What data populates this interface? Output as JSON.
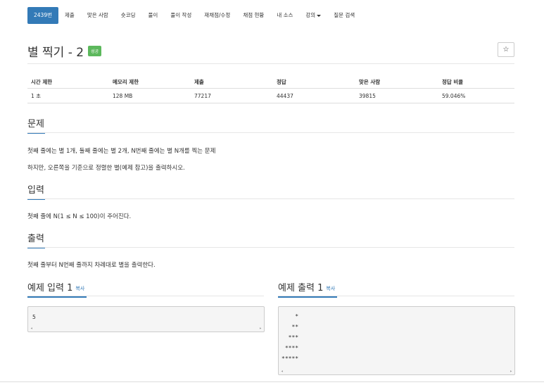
{
  "nav": {
    "tabs": [
      "2439번",
      "제출",
      "맞은 사람",
      "숏코딩",
      "풀이",
      "풀이 작성",
      "재채점/수정",
      "채점 현황",
      "내 소스",
      "강의",
      "질문 검색"
    ]
  },
  "problem": {
    "title": "별 찍기 - 2",
    "badge": "성공",
    "star_icon": "☆"
  },
  "stats": {
    "headers": [
      "시간 제한",
      "메모리 제한",
      "제출",
      "정답",
      "맞은 사람",
      "정답 비율"
    ],
    "values": [
      "1 초",
      "128 MB",
      "77217",
      "44437",
      "39815",
      "59.046%"
    ]
  },
  "sections": {
    "problem_heading": "문제",
    "problem_line1": "첫째 줄에는 별 1개, 둘째 줄에는 별 2개, N번째 줄에는 별 N개를 찍는 문제",
    "problem_line2": "하지만, 오른쪽을 기준으로 정렬한 별(예제 참고)을 출력하시오.",
    "input_heading": "입력",
    "input_text": "첫째 줄에 N(1 ≤ N ≤ 100)이 주어진다.",
    "output_heading": "출력",
    "output_text": "첫째 줄부터 N번째 줄까지 차례대로 별을 출력한다."
  },
  "samples": {
    "input_heading": "예제 입력 1",
    "output_heading": "예제 출력 1",
    "copy_label": "복사",
    "input_lines": [
      "5"
    ],
    "output_lines": [
      "    *",
      "   **",
      "  ***",
      " ****",
      "*****"
    ]
  },
  "colors": {
    "accent": "#337ab7",
    "success": "#5cb85c"
  }
}
